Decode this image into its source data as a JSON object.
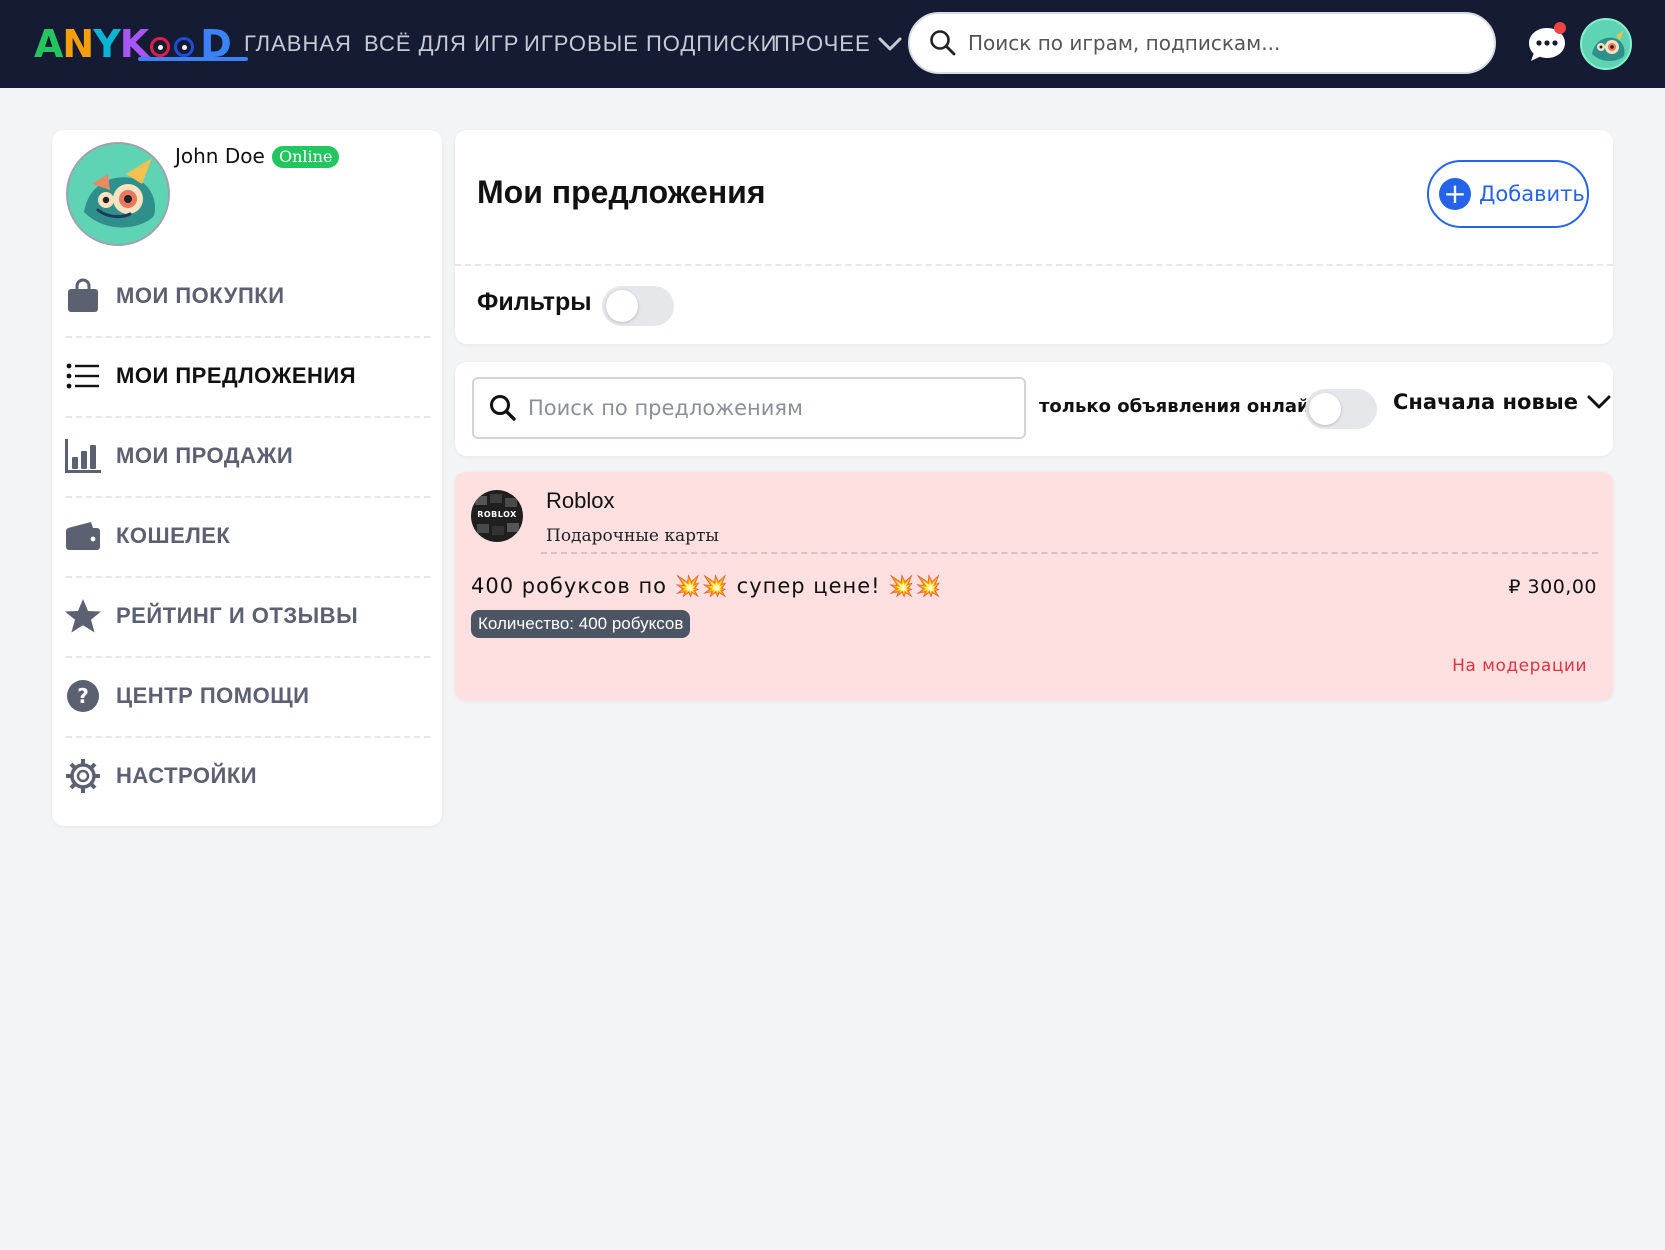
{
  "brand": {
    "logo_text": "ANYKOD",
    "colors": {
      "topbar": "#151b33",
      "accent": "#2563eb",
      "online": "#22c55e",
      "moderation": "#dc3545",
      "offer_bg": "#fde0df"
    }
  },
  "nav": {
    "home": "ГЛАВНАЯ",
    "games": "ВСЁ ДЛЯ ИГР",
    "subscriptions": "ИГРОВЫЕ ПОДПИСКИ",
    "more": "ПРОЧЕЕ"
  },
  "search_top": {
    "placeholder": "Поиск по играм, подпискам..."
  },
  "header_icons": [
    "chat-icon",
    "avatar"
  ],
  "user": {
    "name": "John Doe",
    "status": "Online"
  },
  "sidebar": {
    "items": [
      {
        "label": "МОИ ПОКУПКИ",
        "icon": "shopping-bag-icon",
        "active": false
      },
      {
        "label": "МОИ ПРЕДЛОЖЕНИЯ",
        "icon": "list-icon",
        "active": true
      },
      {
        "label": "МОИ ПРОДАЖИ",
        "icon": "bar-chart-icon",
        "active": false
      },
      {
        "label": "КОШЕЛЕК",
        "icon": "wallet-icon",
        "active": false
      },
      {
        "label": "РЕЙТИНГ И ОТЗЫВЫ",
        "icon": "star-icon",
        "active": false
      },
      {
        "label": "ЦЕНТР ПОМОЩИ",
        "icon": "help-icon",
        "active": false
      },
      {
        "label": "НАСТРОЙКИ",
        "icon": "gear-icon",
        "active": false
      }
    ]
  },
  "main": {
    "title": "Мои предложения",
    "add_label": "Добавить",
    "filters_label": "Фильтры",
    "filters_on": false,
    "offer_search_placeholder": "Поиск по предложениям",
    "online_only_label": "только объявления онлайн",
    "online_only_on": false,
    "sort_label": "Сначала новые"
  },
  "offers": [
    {
      "game": "Roblox",
      "game_logo_text": "ROBLOX",
      "category": "Подарочные карты",
      "title": "400 робуксов по 💥💥 супер цене! 💥💥",
      "price": "₽ 300,00",
      "quantity": "Количество: 400 робуксов",
      "status": "На модерации"
    }
  ]
}
